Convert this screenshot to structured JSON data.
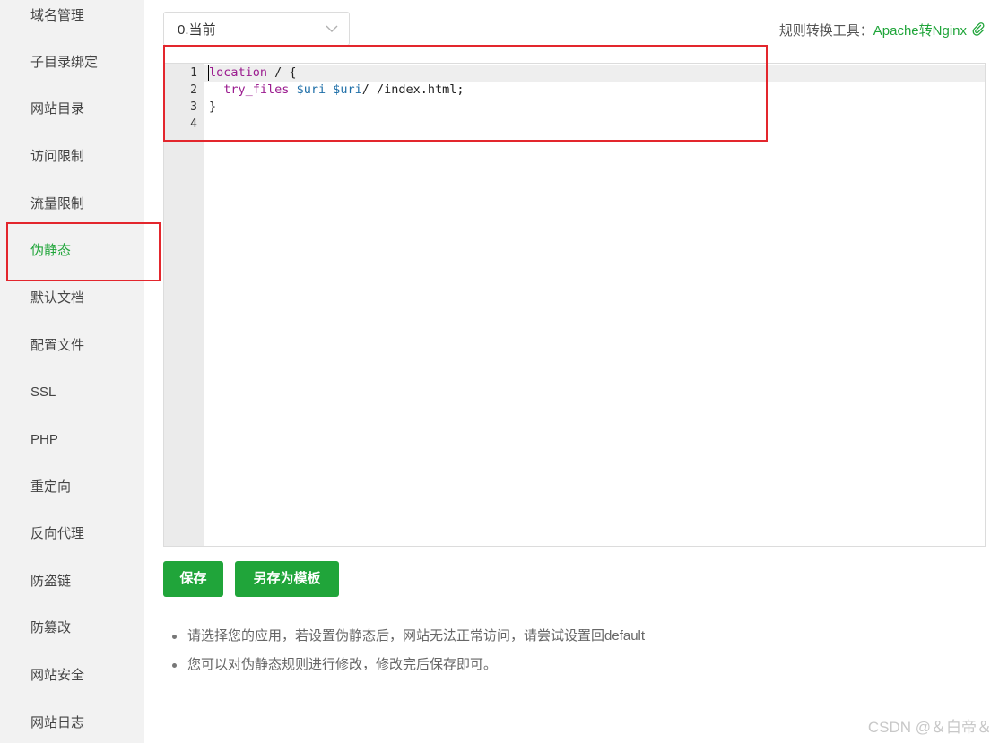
{
  "sidebar": {
    "items": [
      {
        "label": "域名管理",
        "active": false
      },
      {
        "label": "子目录绑定",
        "active": false
      },
      {
        "label": "网站目录",
        "active": false
      },
      {
        "label": "访问限制",
        "active": false
      },
      {
        "label": "流量限制",
        "active": false
      },
      {
        "label": "伪静态",
        "active": true
      },
      {
        "label": "默认文档",
        "active": false
      },
      {
        "label": "配置文件",
        "active": false
      },
      {
        "label": "SSL",
        "active": false
      },
      {
        "label": "PHP",
        "active": false
      },
      {
        "label": "重定向",
        "active": false
      },
      {
        "label": "反向代理",
        "active": false
      },
      {
        "label": "防盗链",
        "active": false
      },
      {
        "label": "防篡改",
        "active": false
      },
      {
        "label": "网站安全",
        "active": false
      },
      {
        "label": "网站日志",
        "active": false
      }
    ]
  },
  "toolbar": {
    "selected_version": "0.当前",
    "tool_label": "规则转换工具：",
    "tool_link": "Apache转Nginx",
    "tool_icon": "paperclip-icon"
  },
  "editor": {
    "line_numbers": [
      "1",
      "2",
      "3",
      "4"
    ],
    "lines": {
      "l1_keyword": "location",
      "l1_rest": " / {",
      "l2_indent": "  ",
      "l2_keyword": "try_files",
      "l2_space1": " ",
      "l2_var1": "$uri",
      "l2_space2": " ",
      "l2_var2": "$uri",
      "l2_rest": "/ /index.html;",
      "l3": "}",
      "l4": ""
    }
  },
  "buttons": {
    "save_label": "保存",
    "save_template_label": "另存为模板"
  },
  "tips": [
    "请选择您的应用，若设置伪静态后，网站无法正常访问，请尝试设置回default",
    "您可以对伪静态规则进行修改，修改完后保存即可。"
  ],
  "watermark": "CSDN @＆白帝＆",
  "colors": {
    "accent": "#20a53a",
    "highlight_border": "#e3262d",
    "sidebar_bg": "#f2f2f2"
  }
}
